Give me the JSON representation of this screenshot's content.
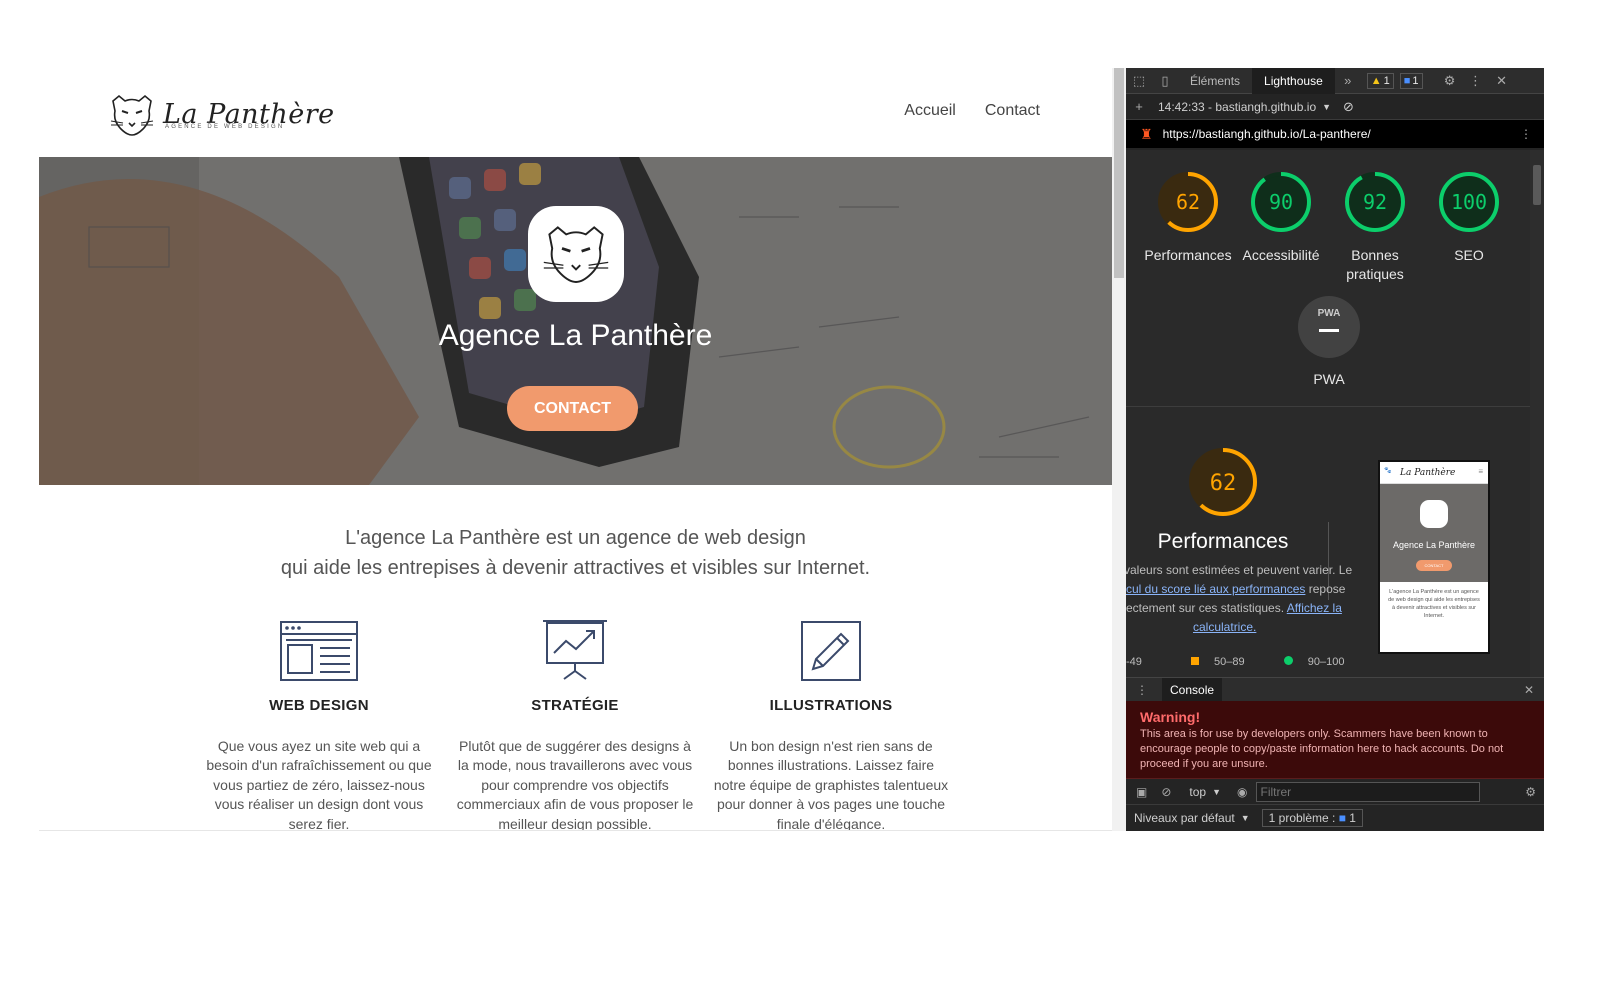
{
  "site": {
    "logo_title": "La Panthère",
    "logo_tagline": "AGENCE DE WEB DESIGN",
    "nav": [
      "Accueil",
      "Contact"
    ],
    "hero_title": "Agence La Panthère",
    "hero_button": "CONTACT",
    "intro_line1": "L'agence La Panthère est un agence de web design",
    "intro_line2": "qui aide les entrepises à devenir attractives et visibles sur Internet.",
    "services": [
      {
        "icon": "browser-window-icon",
        "title": "WEB DESIGN",
        "text": "Que vous ayez un site web qui a besoin d'un rafraîchissement ou que vous partiez de zéro, laissez-nous vous réaliser un design dont vous serez fier."
      },
      {
        "icon": "presentation-chart-icon",
        "title": "STRATÉGIE",
        "text": "Plutôt que de suggérer des designs à la mode, nous travaillerons avec vous pour comprendre vos objectifs commerciaux afin de vous proposer le meilleur design possible."
      },
      {
        "icon": "pencil-icon",
        "title": "ILLUSTRATIONS",
        "text": "Un bon design n'est rien sans de bonnes illustrations. Laissez faire notre équipe de graphistes talentueux pour donner à vos pages une touche finale d'élégance."
      }
    ],
    "accent_color": "#f19a6d"
  },
  "devtools": {
    "tabs": [
      "Éléments",
      "Lighthouse"
    ],
    "active_tab": "Lighthouse",
    "warnings_count": "1",
    "messages_count": "1",
    "report_time": "14:42:33 - bastiangh.github.io",
    "report_url": "https://bastiangh.github.io/La-panthere/",
    "scores": [
      {
        "value": 62,
        "label": "Performances",
        "color": "#ffa400"
      },
      {
        "value": 90,
        "label": "Accessibilité",
        "color": "#0cce6b"
      },
      {
        "value": 92,
        "label": "Bonnes pratiques",
        "color": "#0cce6b"
      },
      {
        "value": 100,
        "label": "SEO",
        "color": "#0cce6b"
      }
    ],
    "pwa_label": "PWA",
    "pwa_badge": "PWA",
    "perf_score": 62,
    "perf_title": "Performances",
    "perf_desc_1": "valeurs sont estimées et peuvent varier. Le",
    "perf_desc_link1": "cul du score lié aux performances",
    "perf_desc_2": " repose",
    "perf_desc_3": "ectement sur ces statistiques. ",
    "perf_desc_link2": "Affichez la",
    "perf_desc_link3": "calculatrice.",
    "legend": [
      "-49",
      "50–89",
      "90–100"
    ],
    "thumb_title": "La Panthère",
    "thumb_hero": "Agence La Panthère",
    "thumb_btn": "CONTACT",
    "thumb_text": "L'agence La Panthère est un agence de web design qui aide les entrepises à devenir attractives et visibles sur Internet.",
    "console_tab": "Console",
    "warning_title": "Warning!",
    "warning_text": "This area is for use by developers only. Scammers have been known to encourage people to copy/paste information here to hack accounts. Do not proceed if you are unsure.",
    "context": "top",
    "filter_placeholder": "Filtrer",
    "levels": "Niveaux par défaut",
    "problems": "1 problème :",
    "problems_count": "1"
  }
}
